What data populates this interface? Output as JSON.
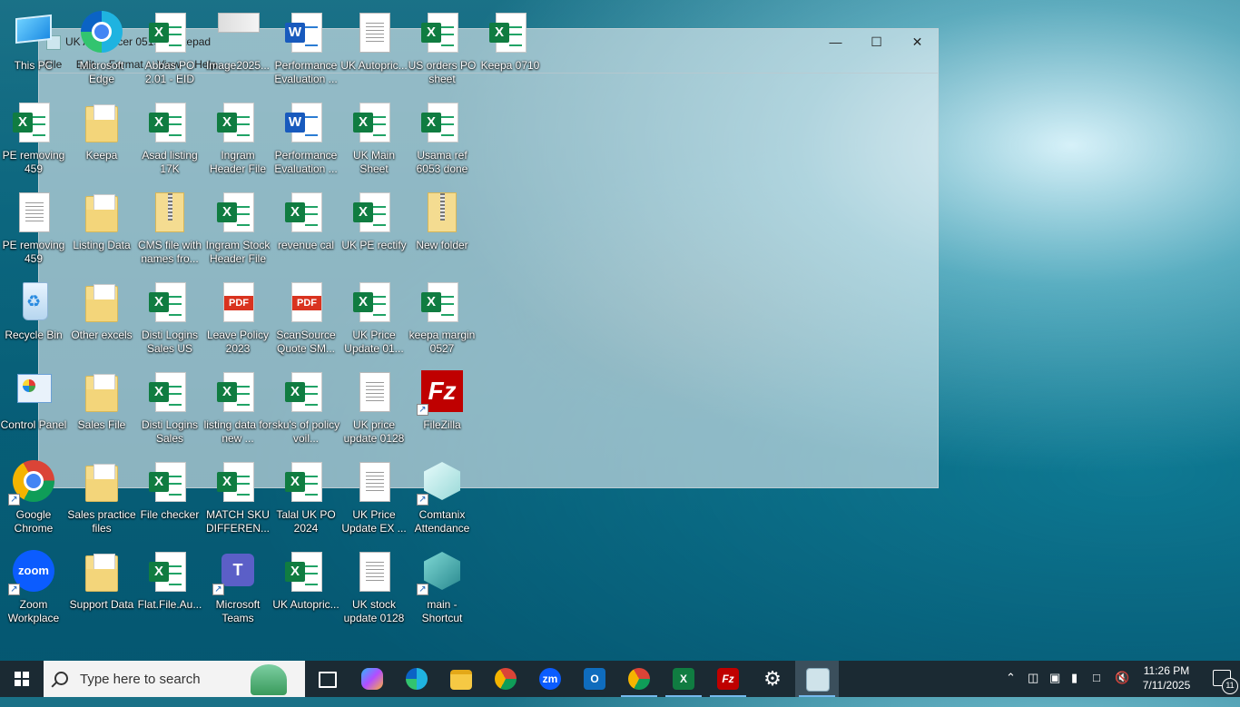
{
  "notepad": {
    "title": "UK Autopricer 0519 - Notepad",
    "menu": [
      "File",
      "Edit",
      "Format",
      "View",
      "Help"
    ],
    "controls": {
      "minimize": "—",
      "maximize": "☐",
      "close": "✕"
    }
  },
  "desktop_icons": {
    "this_pc": "This PC",
    "edge": "Microsoft Edge",
    "abbas_po": "Abbas PO 2.01 - EID",
    "image2025": "Image2025...",
    "perf_eval_1": "Performance Evaluation ...",
    "uk_autopric_txt": "UK Autopric...",
    "us_orders_po": "US orders PO sheet",
    "keepa_0710": "Keepa 0710",
    "pe_removing_459_xlsx": "PE removing 459",
    "keepa_folder": "Keepa",
    "asad_listing": "Asad listing 17K",
    "ingram_header": "Ingram Header File",
    "perf_eval_2": "Performance Evaluation ...",
    "uk_main_sheet": "UK Main Sheet",
    "usama_ref": "Usama ref 6053 done",
    "pe_removing_459_txt": "PE removing 459",
    "listing_data": "Listing Data",
    "cms_file": "CMS file with names fro...",
    "ingram_stock_header": "Ingram Stock Header File",
    "revenue_cal": "revenue cal",
    "uk_pe_rectify": "UK PE rectify",
    "new_folder": "New folder",
    "recycle_bin": "Recycle Bin",
    "other_excels": "Other excels",
    "disti_logins_us": "Disti Logins Sales US",
    "leave_policy": "Leave Policy 2023",
    "scansource": "ScanSource Quote SM...",
    "uk_price_update_01": "UK Price Update 01...",
    "keepa_margin": "keepa margin 0527",
    "control_panel": "Control Panel",
    "sales_file": "Sales File",
    "disti_logins_sales": "Disti Logins Sales",
    "listing_data_new": "listing data for new ...",
    "skus_policy": "sku's of policy voil...",
    "uk_price_update_0128": "UK price update 0128",
    "filezilla": "FileZilla",
    "google_chrome": "Google Chrome",
    "sales_practice": "Sales practice files",
    "file_checker": "File checker",
    "match_sku": "MATCH SKU DIFFEREN...",
    "talal_uk_po": "Talal UK PO 2024",
    "uk_price_update_ex": "UK Price Update EX ...",
    "comtanix": "Comtanix Attendance",
    "zoom_workplace": "Zoom Workplace",
    "support_data": "Support Data",
    "flat_file": "Flat.File.Au...",
    "ms_teams": "Microsoft Teams",
    "uk_autopric_xlsx": "UK Autopric...",
    "uk_stock_update": "UK stock update 0128",
    "main_shortcut": "main - Shortcut"
  },
  "pdf_badge": "PDF",
  "taskbar": {
    "search_placeholder": "Type here to search",
    "time": "11:26 PM",
    "date": "7/11/2025",
    "notifications": "11",
    "app_labels": {
      "zoom": "zm",
      "outlook": "O",
      "excel": "X",
      "filezilla": "Fz"
    }
  }
}
